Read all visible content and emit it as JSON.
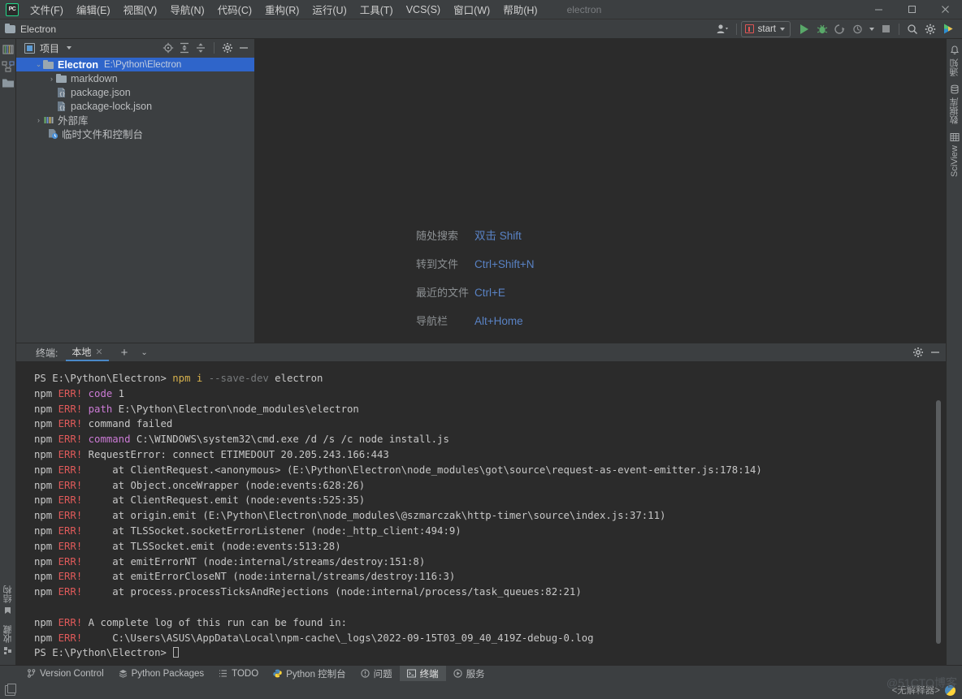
{
  "window": {
    "title": "electron",
    "controls": {
      "minimize": "—",
      "maximize": "☐",
      "close": "✕"
    }
  },
  "menubar": {
    "logo": "PC",
    "items": [
      {
        "label": "文件(F)",
        "name": "menu-file"
      },
      {
        "label": "编辑(E)",
        "name": "menu-edit"
      },
      {
        "label": "视图(V)",
        "name": "menu-view"
      },
      {
        "label": "导航(N)",
        "name": "menu-navigate"
      },
      {
        "label": "代码(C)",
        "name": "menu-code"
      },
      {
        "label": "重构(R)",
        "name": "menu-refactor"
      },
      {
        "label": "运行(U)",
        "name": "menu-run"
      },
      {
        "label": "工具(T)",
        "name": "menu-tools"
      },
      {
        "label": "VCS(S)",
        "name": "menu-vcs"
      },
      {
        "label": "窗口(W)",
        "name": "menu-window"
      },
      {
        "label": "帮助(H)",
        "name": "menu-help"
      }
    ]
  },
  "toolbar": {
    "project_name": "Electron",
    "run_config": "start",
    "icons": {
      "user": "👤",
      "run": "run-icon",
      "debug": "debug-icon",
      "coverage": "coverage-icon",
      "profile": "profile-icon",
      "stop": "stop-icon",
      "search": "🔍",
      "settings": "⚙",
      "updates": "updates-icon"
    }
  },
  "project_panel": {
    "title": "项目",
    "tree": [
      {
        "label": "Electron",
        "path": "E:\\Python\\Electron",
        "icon": "folder",
        "arrow": "⌄",
        "indent": 0,
        "selected": true,
        "bold": true
      },
      {
        "label": "markdown",
        "path": "",
        "icon": "folder",
        "arrow": "›",
        "indent": 1,
        "selected": false,
        "bold": false
      },
      {
        "label": "package.json",
        "path": "",
        "icon": "json",
        "arrow": "",
        "indent": 1,
        "selected": false,
        "bold": false
      },
      {
        "label": "package-lock.json",
        "path": "",
        "icon": "json",
        "arrow": "",
        "indent": 1,
        "selected": false,
        "bold": false
      },
      {
        "label": "外部库",
        "path": "",
        "icon": "library",
        "arrow": "›",
        "indent": 0,
        "selected": false,
        "bold": false
      },
      {
        "label": "临时文件和控制台",
        "path": "",
        "icon": "scratch",
        "arrow": "",
        "indent": 0,
        "selected": false,
        "bold": false
      }
    ]
  },
  "editor_hints": [
    {
      "action": "随处搜索",
      "shortcut": "双击 Shift"
    },
    {
      "action": "转到文件",
      "shortcut": "Ctrl+Shift+N"
    },
    {
      "action": "最近的文件",
      "shortcut": "Ctrl+E"
    },
    {
      "action": "导航栏",
      "shortcut": "Alt+Home"
    }
  ],
  "terminal": {
    "label": "终端:",
    "tab": "本地",
    "close": "✕",
    "add": "+",
    "dropdown": "⌄",
    "lines": [
      {
        "segs": [
          {
            "t": "PS E:\\Python\\Electron> ",
            "c": "c-txt"
          },
          {
            "t": "npm",
            "c": "c-npm"
          },
          {
            "t": " ",
            "c": "c-txt"
          },
          {
            "t": "i",
            "c": "c-npm"
          },
          {
            "t": " ",
            "c": "c-txt"
          },
          {
            "t": "--save-dev",
            "c": "c-dim"
          },
          {
            "t": " electron",
            "c": "c-txt"
          }
        ]
      },
      {
        "segs": [
          {
            "t": "npm ",
            "c": "c-txt"
          },
          {
            "t": "ERR!",
            "c": "c-err"
          },
          {
            "t": " ",
            "c": "c-txt"
          },
          {
            "t": "code",
            "c": "c-key"
          },
          {
            "t": " 1",
            "c": "c-txt"
          }
        ]
      },
      {
        "segs": [
          {
            "t": "npm ",
            "c": "c-txt"
          },
          {
            "t": "ERR!",
            "c": "c-err"
          },
          {
            "t": " ",
            "c": "c-txt"
          },
          {
            "t": "path",
            "c": "c-key"
          },
          {
            "t": " E:\\Python\\Electron\\node_modules\\electron",
            "c": "c-txt"
          }
        ]
      },
      {
        "segs": [
          {
            "t": "npm ",
            "c": "c-txt"
          },
          {
            "t": "ERR!",
            "c": "c-err"
          },
          {
            "t": " command failed",
            "c": "c-txt"
          }
        ]
      },
      {
        "segs": [
          {
            "t": "npm ",
            "c": "c-txt"
          },
          {
            "t": "ERR!",
            "c": "c-err"
          },
          {
            "t": " ",
            "c": "c-txt"
          },
          {
            "t": "command",
            "c": "c-key"
          },
          {
            "t": " C:\\WINDOWS\\system32\\cmd.exe /d /s /c node install.js",
            "c": "c-txt"
          }
        ]
      },
      {
        "segs": [
          {
            "t": "npm ",
            "c": "c-txt"
          },
          {
            "t": "ERR!",
            "c": "c-err"
          },
          {
            "t": " RequestError: connect ETIMEDOUT 20.205.243.166:443",
            "c": "c-txt"
          }
        ]
      },
      {
        "segs": [
          {
            "t": "npm ",
            "c": "c-txt"
          },
          {
            "t": "ERR!",
            "c": "c-err"
          },
          {
            "t": "     at ClientRequest.<anonymous> (E:\\Python\\Electron\\node_modules\\got\\source\\request-as-event-emitter.js:178:14)",
            "c": "c-txt"
          }
        ]
      },
      {
        "segs": [
          {
            "t": "npm ",
            "c": "c-txt"
          },
          {
            "t": "ERR!",
            "c": "c-err"
          },
          {
            "t": "     at Object.onceWrapper (node:events:628:26)",
            "c": "c-txt"
          }
        ]
      },
      {
        "segs": [
          {
            "t": "npm ",
            "c": "c-txt"
          },
          {
            "t": "ERR!",
            "c": "c-err"
          },
          {
            "t": "     at ClientRequest.emit (node:events:525:35)",
            "c": "c-txt"
          }
        ]
      },
      {
        "segs": [
          {
            "t": "npm ",
            "c": "c-txt"
          },
          {
            "t": "ERR!",
            "c": "c-err"
          },
          {
            "t": "     at origin.emit (E:\\Python\\Electron\\node_modules\\@szmarczak\\http-timer\\source\\index.js:37:11)",
            "c": "c-txt"
          }
        ]
      },
      {
        "segs": [
          {
            "t": "npm ",
            "c": "c-txt"
          },
          {
            "t": "ERR!",
            "c": "c-err"
          },
          {
            "t": "     at TLSSocket.socketErrorListener (node:_http_client:494:9)",
            "c": "c-txt"
          }
        ]
      },
      {
        "segs": [
          {
            "t": "npm ",
            "c": "c-txt"
          },
          {
            "t": "ERR!",
            "c": "c-err"
          },
          {
            "t": "     at TLSSocket.emit (node:events:513:28)",
            "c": "c-txt"
          }
        ]
      },
      {
        "segs": [
          {
            "t": "npm ",
            "c": "c-txt"
          },
          {
            "t": "ERR!",
            "c": "c-err"
          },
          {
            "t": "     at emitErrorNT (node:internal/streams/destroy:151:8)",
            "c": "c-txt"
          }
        ]
      },
      {
        "segs": [
          {
            "t": "npm ",
            "c": "c-txt"
          },
          {
            "t": "ERR!",
            "c": "c-err"
          },
          {
            "t": "     at emitErrorCloseNT (node:internal/streams/destroy:116:3)",
            "c": "c-txt"
          }
        ]
      },
      {
        "segs": [
          {
            "t": "npm ",
            "c": "c-txt"
          },
          {
            "t": "ERR!",
            "c": "c-err"
          },
          {
            "t": "     at process.processTicksAndRejections (node:internal/process/task_queues:82:21)",
            "c": "c-txt"
          }
        ]
      },
      {
        "segs": []
      },
      {
        "segs": [
          {
            "t": "npm ",
            "c": "c-txt"
          },
          {
            "t": "ERR!",
            "c": "c-err"
          },
          {
            "t": " A complete log of this run can be found in:",
            "c": "c-txt"
          }
        ]
      },
      {
        "segs": [
          {
            "t": "npm ",
            "c": "c-txt"
          },
          {
            "t": "ERR!",
            "c": "c-err"
          },
          {
            "t": "     C:\\Users\\ASUS\\AppData\\Local\\npm-cache\\_logs\\2022-09-15T03_09_40_419Z-debug-0.log",
            "c": "c-txt"
          }
        ]
      },
      {
        "segs": [
          {
            "t": "PS E:\\Python\\Electron> ",
            "c": "c-txt"
          }
        ],
        "cursor": true
      }
    ]
  },
  "left_stripe": {
    "top_icons": [
      "project-icon",
      "structure-icon",
      "folder-icon"
    ],
    "bottom_labels": [
      "结构",
      "收藏"
    ]
  },
  "right_stripe": {
    "labels": [
      "通知",
      "数据库",
      "SciView"
    ]
  },
  "bottom_bar": {
    "items": [
      {
        "label": "Version Control",
        "icon": "⑂",
        "active": false,
        "name": "bottom-tab-version-control"
      },
      {
        "label": "Python Packages",
        "icon": "☲",
        "active": false,
        "name": "bottom-tab-python-packages"
      },
      {
        "label": "TODO",
        "icon": "☰",
        "active": false,
        "name": "bottom-tab-todo"
      },
      {
        "label": "Python 控制台",
        "icon": "py",
        "active": false,
        "name": "bottom-tab-python-console"
      },
      {
        "label": "问题",
        "icon": "ℹ",
        "active": false,
        "name": "bottom-tab-problems"
      },
      {
        "label": "终端",
        "icon": "▣",
        "active": true,
        "name": "bottom-tab-terminal"
      },
      {
        "label": "服务",
        "icon": "▶",
        "active": false,
        "name": "bottom-tab-services"
      }
    ]
  },
  "status_bar": {
    "interpreter": "<无解释器>",
    "watermark": "@51CTO博客"
  },
  "colors": {
    "accent_blue": "#2f65ca",
    "link_blue": "#5982c4",
    "error_red": "#e05a5a",
    "run_green": "#59a869",
    "panel_bg": "#3c3f41",
    "editor_bg": "#2b2b2b"
  }
}
